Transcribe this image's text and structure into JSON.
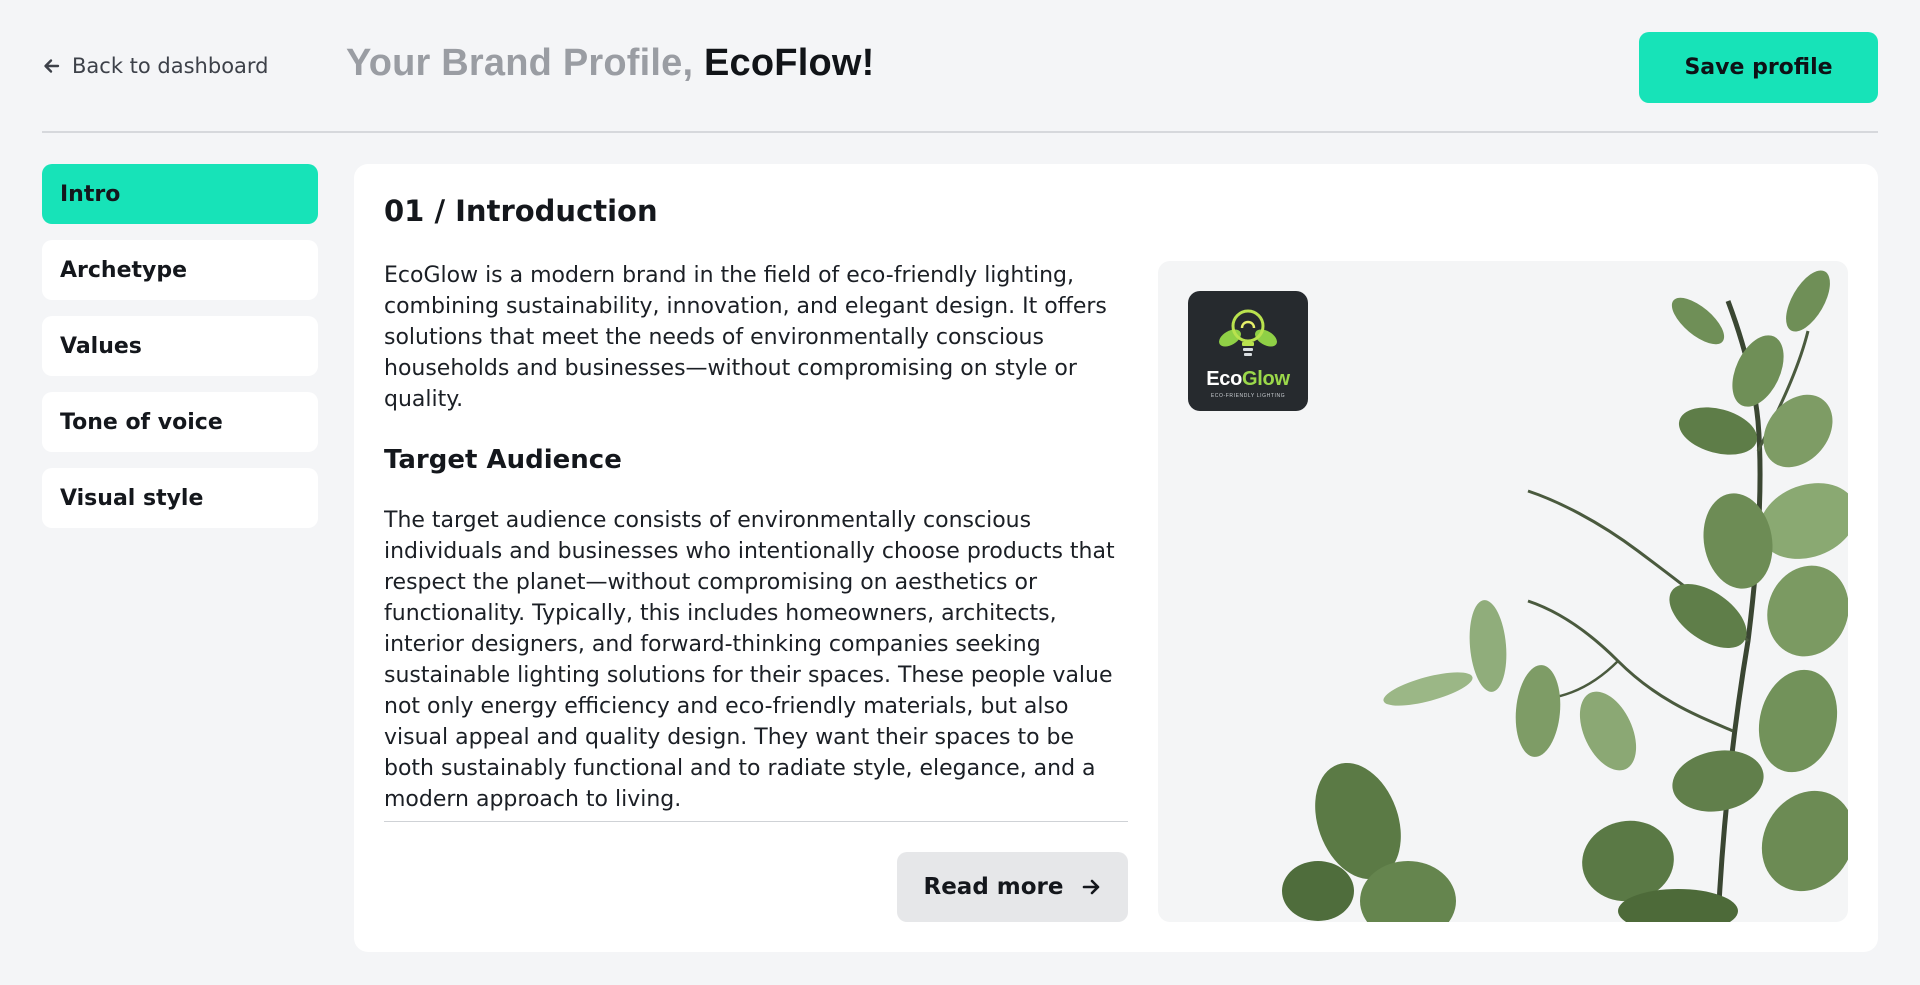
{
  "header": {
    "back_label": "Back to dashboard",
    "title_prefix": "Your Brand Profile,",
    "title_brand": "EcoFlow!",
    "save_label": "Save profile"
  },
  "sidebar": {
    "items": [
      {
        "label": "Intro",
        "active": true
      },
      {
        "label": "Archetype",
        "active": false
      },
      {
        "label": "Values",
        "active": false
      },
      {
        "label": "Tone of voice",
        "active": false
      },
      {
        "label": "Visual style",
        "active": false
      }
    ]
  },
  "main": {
    "section_title": "01 / Introduction",
    "intro_text": "EcoGlow is a modern brand in the field of eco-friendly lighting, combining sustainability, innovation, and elegant design. It offers solutions that meet the needs of environmentally conscious households and businesses—without compromising on style or quality.",
    "audience_title": "Target Audience",
    "audience_text": "The target audience consists of environmentally conscious individuals and businesses who intentionally choose products that respect the planet—without compromising on aesthetics or functionality. Typically, this includes homeowners, architects, interior designers, and forward-thinking companies seeking sustainable lighting solutions for their spaces. These people value not only energy efficiency and eco-friendly materials, but also visual appeal and quality design. They want their spaces to be both sustainably functional and to radiate style, elegance, and a modern approach to living.",
    "read_more_label": "Read more"
  },
  "logo": {
    "name_part1": "Eco",
    "name_part2": "Glow",
    "tagline": "ECO-FRIENDLY LIGHTING"
  },
  "colors": {
    "accent": "#17e3b8",
    "background": "#f4f5f7",
    "card": "#ffffff",
    "logo_green": "#9bd84a"
  }
}
